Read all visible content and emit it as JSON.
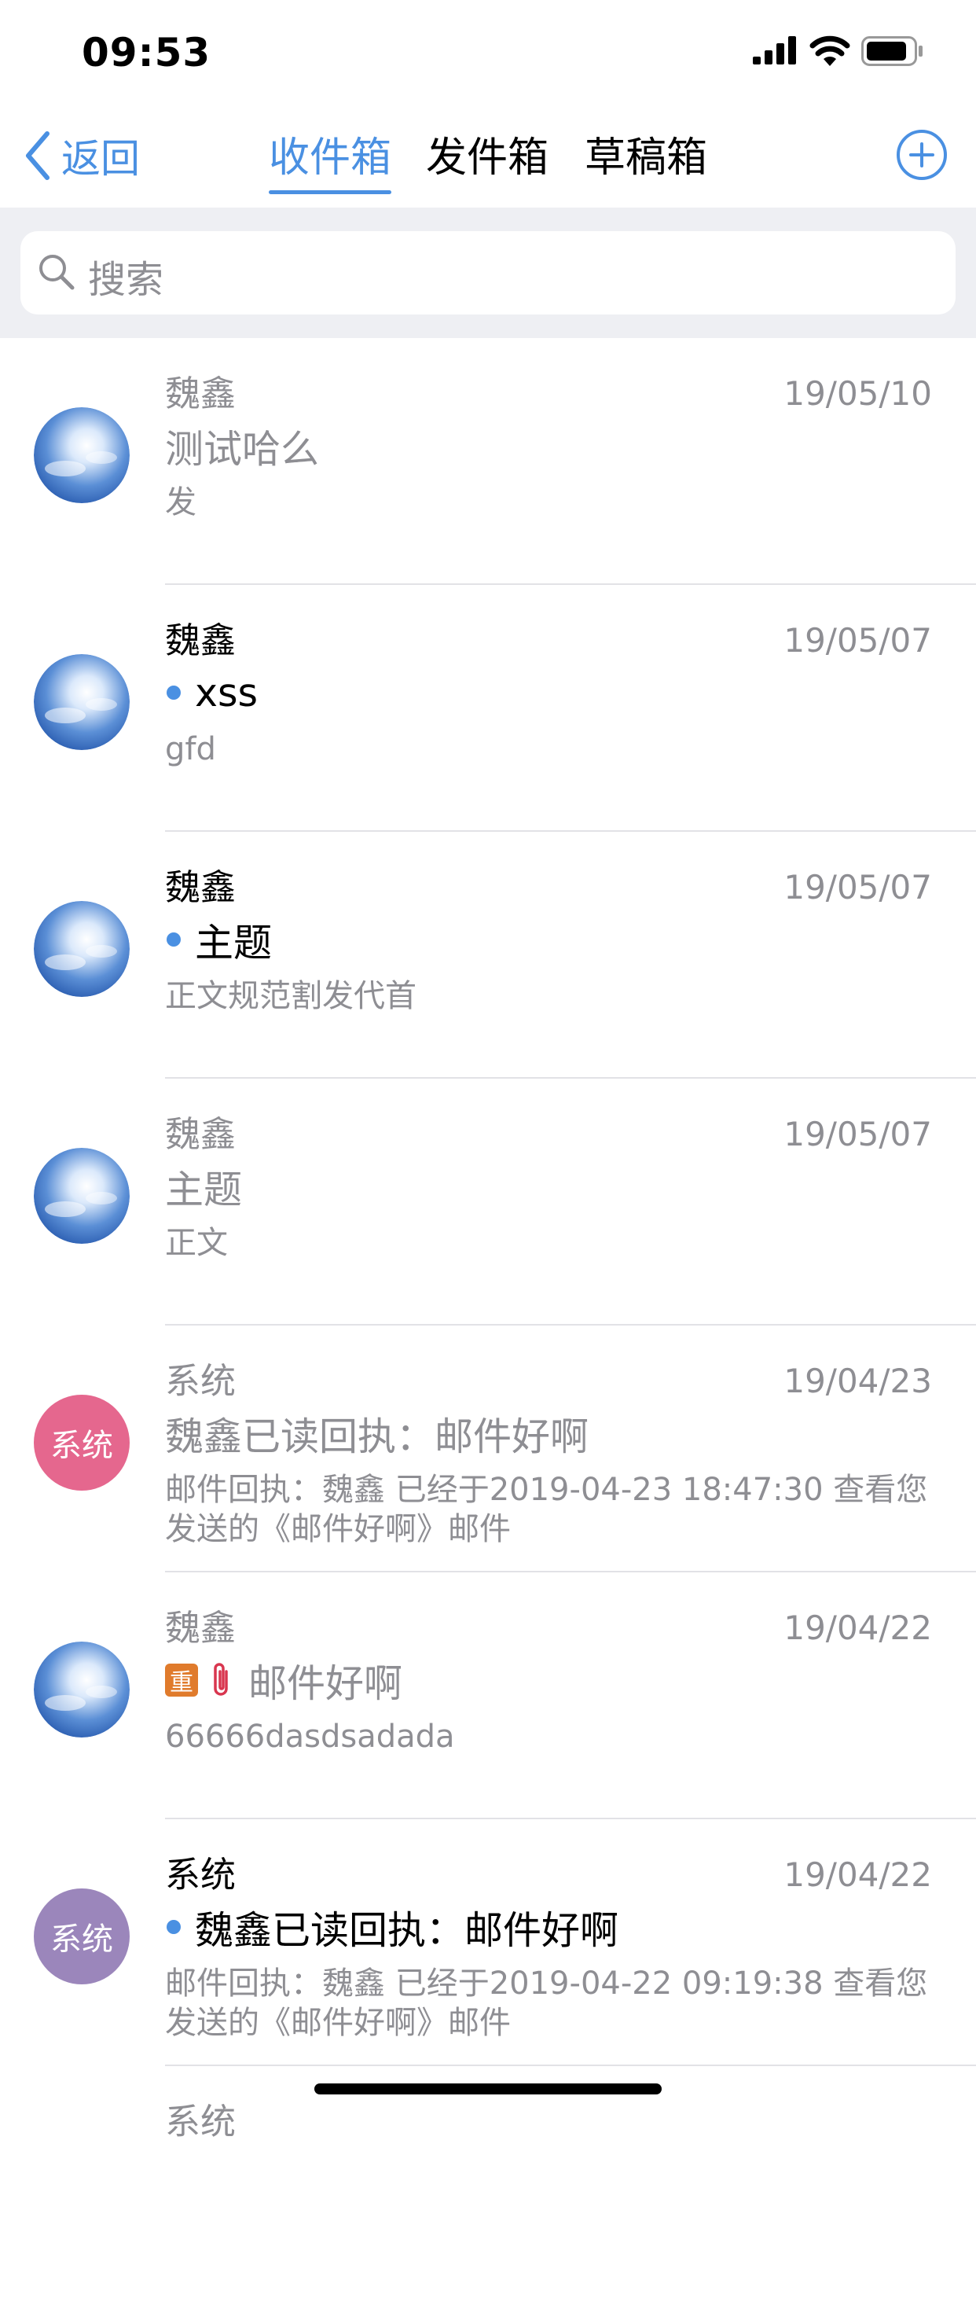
{
  "status_bar": {
    "time": "09:53"
  },
  "nav": {
    "back_label": "返回",
    "tabs": [
      {
        "label": "收件箱",
        "active": true
      },
      {
        "label": "发件箱",
        "active": false
      },
      {
        "label": "草稿箱",
        "active": false
      }
    ],
    "add_icon": "plus-circle-icon"
  },
  "search": {
    "placeholder": "搜索"
  },
  "colors": {
    "accent": "#4a90e2",
    "system_avatar_pink": "#e5678e",
    "system_avatar_purple": "#9b86bb",
    "important_badge": "#e07b2c",
    "attachment": "#d9364f"
  },
  "mails": [
    {
      "sender": "魏鑫",
      "date": "19/05/10",
      "subject": "测试哈么",
      "preview": "发",
      "unread": false,
      "avatar": "sky-photo"
    },
    {
      "sender": "魏鑫",
      "date": "19/05/07",
      "subject": "xss",
      "preview": "gfd",
      "unread": true,
      "avatar": "sky-photo"
    },
    {
      "sender": "魏鑫",
      "date": "19/05/07",
      "subject": "主题",
      "preview": "正文规范割发代首",
      "unread": true,
      "avatar": "sky-photo"
    },
    {
      "sender": "魏鑫",
      "date": "19/05/07",
      "subject": "主题",
      "preview": "正文",
      "unread": false,
      "avatar": "sky-photo"
    },
    {
      "sender": "系统",
      "date": "19/04/23",
      "subject": "魏鑫已读回执：邮件好啊",
      "preview": "邮件回执：魏鑫 已经于2019-04-23 18:47:30 查看您发送的《邮件好啊》邮件",
      "unread": false,
      "avatar": "system-pink",
      "avatar_label": "系统"
    },
    {
      "sender": "魏鑫",
      "date": "19/04/22",
      "subject": "邮件好啊",
      "preview": "66666dasdsadada",
      "unread": false,
      "avatar": "sky-photo",
      "important_label": "重",
      "attachment_icon": "paperclip-icon"
    },
    {
      "sender": "系统",
      "date": "19/04/22",
      "subject": "魏鑫已读回执：邮件好啊",
      "preview": "邮件回执：魏鑫 已经于2019-04-22 09:19:38 查看您发送的《邮件好啊》邮件",
      "unread": true,
      "avatar": "system-purple",
      "avatar_label": "系统"
    },
    {
      "sender": "系统",
      "date": "",
      "subject": "",
      "preview": "",
      "unread": false,
      "avatar": "system-pink"
    }
  ]
}
